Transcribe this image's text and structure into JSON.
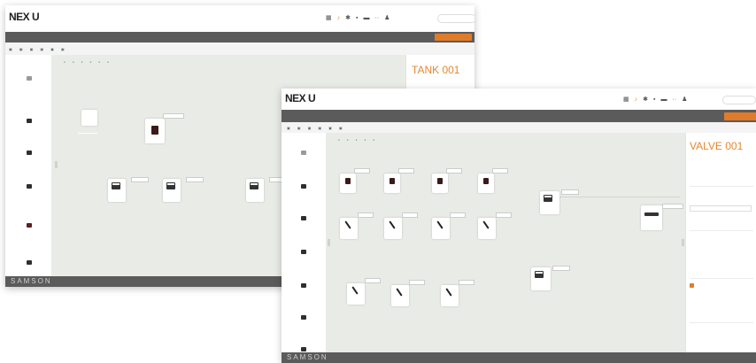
{
  "back_window": {
    "logo": "NEX U",
    "logo_sub": "",
    "user": "",
    "nav_items": [
      "",
      "",
      "",
      "",
      "",
      ""
    ],
    "nav_button": "",
    "sub_items": [
      "",
      "",
      "",
      "",
      "",
      ""
    ],
    "tools": [
      "",
      "",
      "",
      "",
      "",
      ""
    ],
    "tabs": [
      "",
      ""
    ],
    "right_buttons": [
      "",
      ""
    ],
    "panel_title": "TANK 001",
    "panel_fields": [
      {
        "label": "",
        "value": ""
      }
    ],
    "footer_brand": "SAMSON"
  },
  "front_window": {
    "logo": "NEX U",
    "logo_sub": "",
    "user": "",
    "nav_items": [
      "",
      "",
      "",
      "",
      "",
      ""
    ],
    "nav_button": "",
    "sub_items": [
      "",
      "",
      "",
      "",
      "",
      ""
    ],
    "tools": [
      "",
      "",
      "",
      "",
      ""
    ],
    "tabs": [
      "",
      ""
    ],
    "right_button": "",
    "panel_title": "VALVE 001",
    "panel_fields": [
      {
        "label": "",
        "value": ""
      },
      {
        "label": "",
        "value": ""
      },
      {
        "label": "",
        "value": ""
      },
      {
        "label": "",
        "value": ""
      },
      {
        "label": "",
        "value": ""
      },
      {
        "label": "",
        "value": ""
      }
    ],
    "panel_select": "",
    "footer_brand": "SAMSON",
    "footer_small": ""
  },
  "icons": {
    "grid": "grid-icon",
    "alert": "alert-icon",
    "settings": "gear-icon",
    "user": "user-icon",
    "tool": "tool-icon"
  },
  "colors": {
    "accent": "#e07b2a",
    "nav_bg": "#5b5b5b",
    "canvas_bg": "#e9ece6"
  }
}
